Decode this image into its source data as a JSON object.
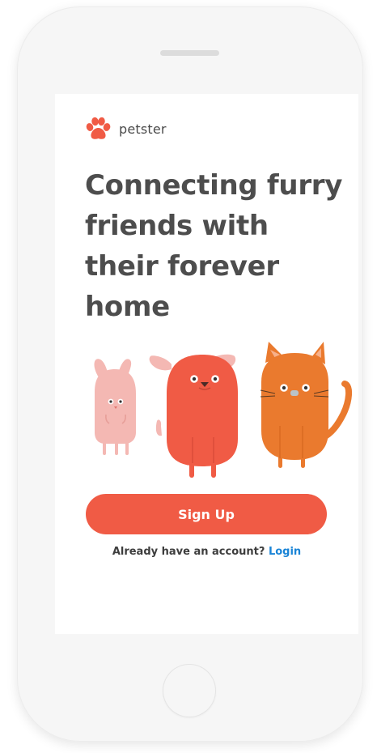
{
  "app": {
    "brand_name": "petster",
    "logo_icon": "paw-icon"
  },
  "hero": {
    "headline": "Connecting furry friends with their forever home"
  },
  "illustration": {
    "animals": [
      "bunny",
      "dog",
      "cat"
    ]
  },
  "actions": {
    "signup_label": "Sign Up",
    "login_prompt": "Already have an account?",
    "login_label": "Login"
  },
  "colors": {
    "accent": "#f05b45",
    "link": "#1a84d6",
    "heading": "#4d4d4d",
    "bunny": "#f4b8b3",
    "dog": "#f05b45",
    "cat": "#ea7a2e"
  }
}
